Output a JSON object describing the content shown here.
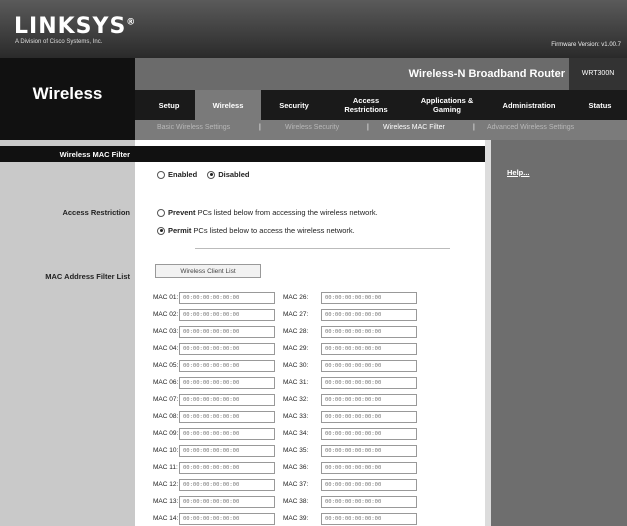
{
  "brand": {
    "logo": "LINKSYS",
    "logo_mark": "®",
    "subtitle": "A Division of Cisco Systems, Inc.",
    "firmware": "Firmware Version: v1.00.7"
  },
  "section": {
    "title": "Wireless"
  },
  "product": {
    "name": "Wireless-N Broadband Router",
    "model": "WRT300N"
  },
  "tabs": [
    {
      "label": "Setup"
    },
    {
      "label": "Wireless"
    },
    {
      "label": "Security"
    },
    {
      "label": "Access Restrictions"
    },
    {
      "label": "Applications & Gaming"
    },
    {
      "label": "Administration"
    },
    {
      "label": "Status"
    }
  ],
  "subtabs": [
    {
      "label": "Basic Wireless Settings"
    },
    {
      "label": "Wireless Security"
    },
    {
      "label": "Wireless MAC Filter"
    },
    {
      "label": "Advanced Wireless Settings"
    }
  ],
  "subtab_separator": "|",
  "left_labels": {
    "mac_filter": "Wireless MAC Filter",
    "access_restriction": "Access Restriction",
    "mac_list": "MAC Address Filter List"
  },
  "help_link": "Help...",
  "filter_mode": {
    "enabled_label": "Enabled",
    "disabled_label": "Disabled",
    "selected": "Disabled"
  },
  "restriction": {
    "prevent_bold": "Prevent",
    "prevent_rest": " PCs listed below from accessing the wireless network.",
    "permit_bold": "Permit",
    "permit_rest": " PCs listed below to access the wireless network.",
    "selected": "Permit"
  },
  "client_list_button": "Wireless Client List",
  "mac_left": [
    {
      "label": "MAC 01:",
      "value": "00:00:00:00:00:00"
    },
    {
      "label": "MAC 02:",
      "value": "00:00:00:00:00:00"
    },
    {
      "label": "MAC 03:",
      "value": "00:00:00:00:00:00"
    },
    {
      "label": "MAC 04:",
      "value": "00:00:00:00:00:00"
    },
    {
      "label": "MAC 05:",
      "value": "00:00:00:00:00:00"
    },
    {
      "label": "MAC 06:",
      "value": "00:00:00:00:00:00"
    },
    {
      "label": "MAC 07:",
      "value": "00:00:00:00:00:00"
    },
    {
      "label": "MAC 08:",
      "value": "00:00:00:00:00:00"
    },
    {
      "label": "MAC 09:",
      "value": "00:00:00:00:00:00"
    },
    {
      "label": "MAC 10:",
      "value": "00:00:00:00:00:00"
    },
    {
      "label": "MAC 11:",
      "value": "00:00:00:00:00:00"
    },
    {
      "label": "MAC 12:",
      "value": "00:00:00:00:00:00"
    },
    {
      "label": "MAC 13:",
      "value": "00:00:00:00:00:00"
    },
    {
      "label": "MAC 14:",
      "value": "00:00:00:00:00:00"
    }
  ],
  "mac_right": [
    {
      "label": "MAC 26:",
      "value": "00:00:00:00:00:00"
    },
    {
      "label": "MAC 27:",
      "value": "00:00:00:00:00:00"
    },
    {
      "label": "MAC 28:",
      "value": "00:00:00:00:00:00"
    },
    {
      "label": "MAC 29:",
      "value": "00:00:00:00:00:00"
    },
    {
      "label": "MAC 30:",
      "value": "00:00:00:00:00:00"
    },
    {
      "label": "MAC 31:",
      "value": "00:00:00:00:00:00"
    },
    {
      "label": "MAC 32:",
      "value": "00:00:00:00:00:00"
    },
    {
      "label": "MAC 33:",
      "value": "00:00:00:00:00:00"
    },
    {
      "label": "MAC 34:",
      "value": "00:00:00:00:00:00"
    },
    {
      "label": "MAC 35:",
      "value": "00:00:00:00:00:00"
    },
    {
      "label": "MAC 36:",
      "value": "00:00:00:00:00:00"
    },
    {
      "label": "MAC 37:",
      "value": "00:00:00:00:00:00"
    },
    {
      "label": "MAC 38:",
      "value": "00:00:00:00:00:00"
    },
    {
      "label": "MAC 39:",
      "value": "00:00:00:00:00:00"
    }
  ]
}
